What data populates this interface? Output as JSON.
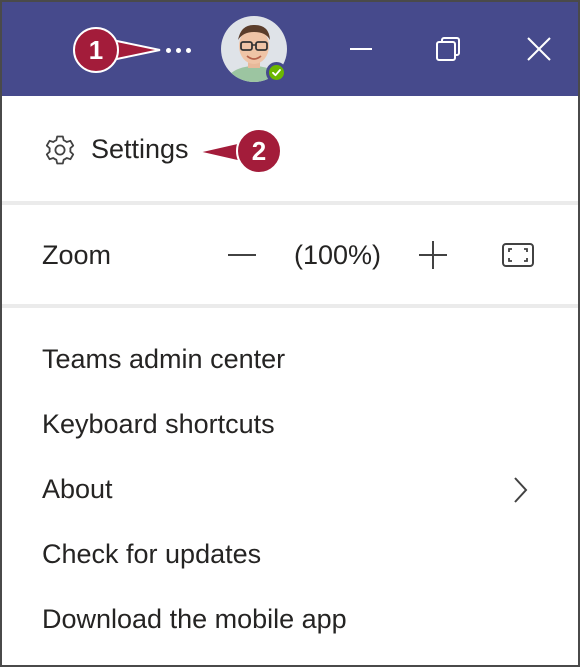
{
  "callouts": {
    "step1": "1",
    "step2": "2"
  },
  "titlebar": {
    "more_icon": "more-options-ellipsis-icon",
    "avatar_status": "available",
    "window_controls": [
      "minimize-icon",
      "restore-icon",
      "close-icon"
    ]
  },
  "menu": {
    "settings_label": "Settings",
    "settings_icon": "gear-icon",
    "zoom": {
      "label": "Zoom",
      "value": "(100%)",
      "zoom_out_icon": "minus-icon",
      "zoom_in_icon": "plus-icon",
      "fullscreen_icon": "fullscreen-icon"
    },
    "items": [
      {
        "label": "Teams admin center"
      },
      {
        "label": "Keyboard shortcuts"
      },
      {
        "label": "About",
        "has_submenu": true
      },
      {
        "label": "Check for updates"
      },
      {
        "label": "Download the mobile app"
      }
    ]
  },
  "colors": {
    "titlebar": "#464a8c",
    "callout": "#a31c3a",
    "presence_available": "#6bb700",
    "text": "#252423",
    "separator": "#ebebeb"
  }
}
